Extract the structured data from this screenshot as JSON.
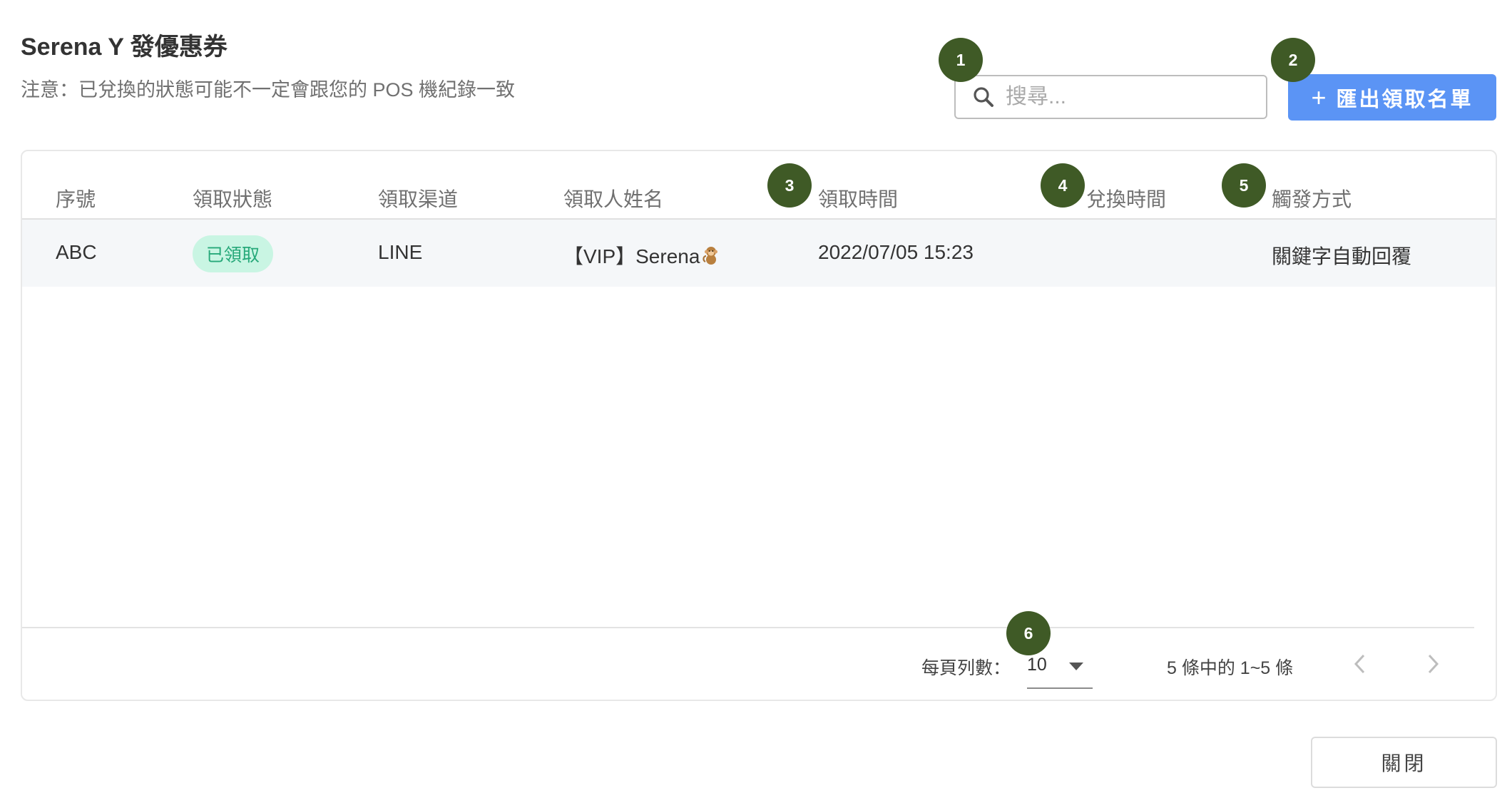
{
  "dialog": {
    "title": "Serena Y 發優惠券",
    "subtitle": "注意：已兌換的狀態可能不一定會跟您的 POS 機紀錄一致"
  },
  "search": {
    "placeholder": "搜尋..."
  },
  "export_button": {
    "icon": "+",
    "label": "匯出領取名單"
  },
  "table": {
    "columns": [
      "序號",
      "領取狀態",
      "領取渠道",
      "領取人姓名",
      "領取時間",
      "兌換時間",
      "觸發方式"
    ],
    "rows": [
      {
        "serial": "ABC",
        "status": "已領取",
        "channel": "LINE",
        "recipient": "【VIP】Serena",
        "received_time": "2022/07/05 15:23",
        "redeemed_time": "",
        "trigger": "關鍵字自動回覆"
      }
    ]
  },
  "pagination": {
    "rows_per_page_label": "每頁列數：",
    "rows_per_page_value": "10",
    "range_text": "5 條中的 1~5 條"
  },
  "close_button": {
    "label": "關閉"
  },
  "markers": [
    "1",
    "2",
    "3",
    "4",
    "5",
    "6"
  ],
  "colors": {
    "accent": "#5b94f5",
    "badge_bg": "#c9f5e3",
    "badge_text": "#27a97a",
    "marker": "#3f5a26"
  }
}
